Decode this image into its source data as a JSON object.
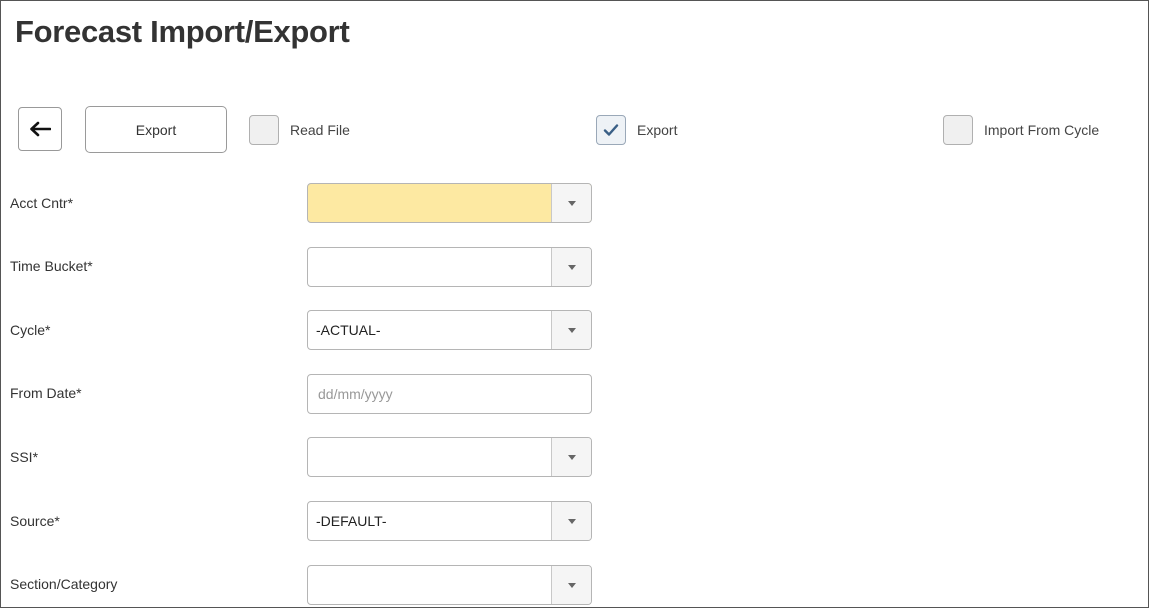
{
  "page": {
    "title": "Forecast Import/Export"
  },
  "toolbar": {
    "export_label": "Export",
    "checkboxes": [
      {
        "label": "Read File",
        "checked": false
      },
      {
        "label": "Export",
        "checked": true
      },
      {
        "label": "Import From Cycle",
        "checked": false
      }
    ]
  },
  "form": {
    "acct_cntr": {
      "label": "Acct Cntr*",
      "value": ""
    },
    "time_bucket": {
      "label": "Time Bucket*",
      "value": ""
    },
    "cycle": {
      "label": "Cycle*",
      "value": "-ACTUAL-"
    },
    "from_date": {
      "label": "From Date*",
      "value": "",
      "placeholder": "dd/mm/yyyy"
    },
    "ssi": {
      "label": "SSI*",
      "value": ""
    },
    "source": {
      "label": "Source*",
      "value": "-DEFAULT-"
    },
    "section_category": {
      "label": "Section/Category",
      "value": ""
    }
  },
  "colors": {
    "required_highlight": "#fde9a2",
    "border": "#b5b5b5",
    "title": "#333333"
  },
  "icons": {
    "back": "arrow-left-icon",
    "dropdown": "caret-down-icon",
    "check": "checkmark-icon"
  }
}
